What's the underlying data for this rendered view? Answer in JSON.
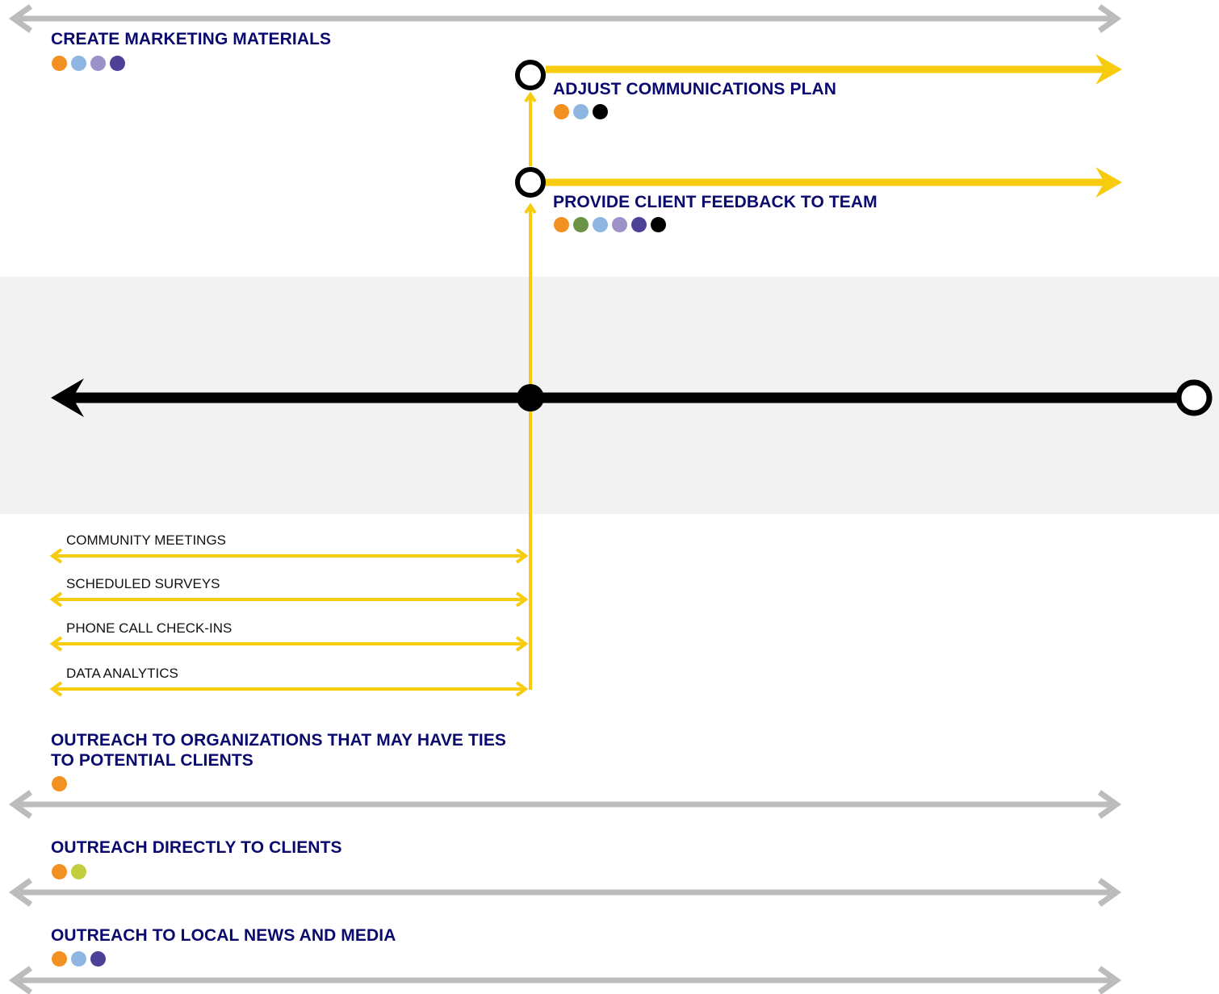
{
  "colors": {
    "gray_arrow": "#bcbcbc",
    "yellow": "#f7cc0f",
    "black": "#000000",
    "band": "#f2f2f2",
    "title_text": "#0a0a6e",
    "orange": "#f39022",
    "green": "#6a9346",
    "light_blue": "#8fb6e2",
    "lavender": "#9c92c8",
    "purple": "#4c4196",
    "lime": "#c3ce3c"
  },
  "top_activity": {
    "title": "CREATE MARKETING MATERIALS",
    "dots": [
      "orange",
      "light_blue",
      "lavender",
      "purple"
    ]
  },
  "feedback_steps": [
    {
      "title": "ADJUST COMMUNICATIONS PLAN",
      "dots": [
        "orange",
        "light_blue",
        "black"
      ]
    },
    {
      "title": "PROVIDE CLIENT FEEDBACK TO TEAM",
      "dots": [
        "orange",
        "green",
        "light_blue",
        "lavender",
        "purple",
        "black"
      ]
    }
  ],
  "feedback_channels": [
    "COMMUNITY MEETINGS",
    "SCHEDULED SURVEYS",
    "PHONE CALL CHECK-INS",
    "DATA ANALYTICS"
  ],
  "outreach": [
    {
      "title": "OUTREACH TO ORGANIZATIONS THAT MAY HAVE TIES TO POTENTIAL CLIENTS",
      "dots": [
        "orange"
      ]
    },
    {
      "title": "OUTREACH DIRECTLY TO CLIENTS",
      "dots": [
        "orange",
        "lime"
      ]
    },
    {
      "title": "OUTREACH TO LOCAL NEWS AND MEDIA",
      "dots": [
        "orange",
        "light_blue",
        "purple"
      ]
    }
  ]
}
